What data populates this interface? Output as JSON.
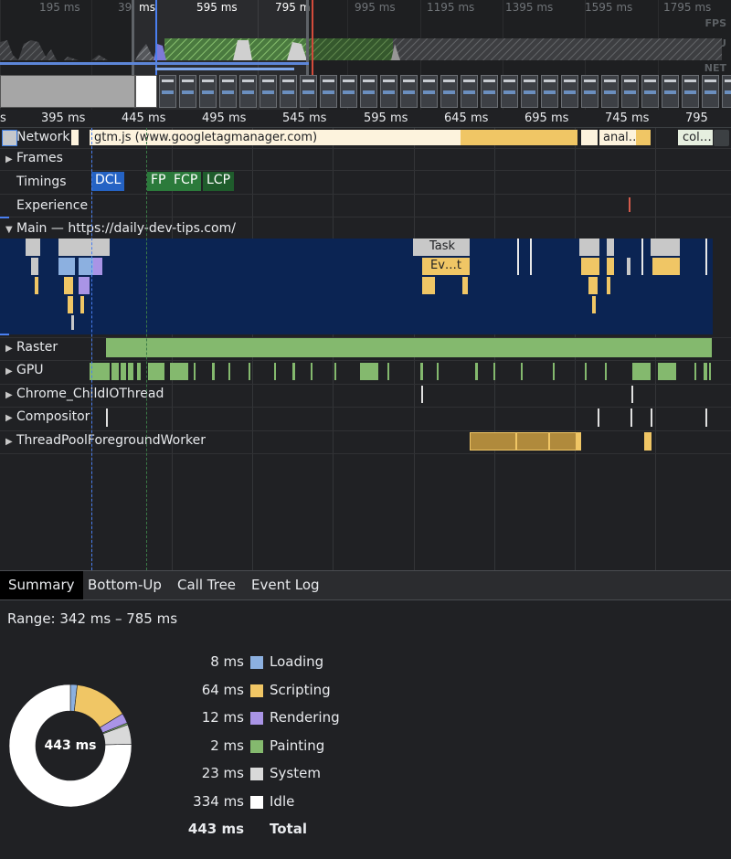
{
  "overview": {
    "ticks": [
      "195 ms",
      "39",
      "ms",
      "595 ms",
      "795 m",
      "995 ms",
      "1195 ms",
      "1395 ms",
      "1595 ms",
      "1795 ms"
    ],
    "row_labels": [
      "FPS",
      "CPU",
      "NET"
    ]
  },
  "ruler": {
    "labels": [
      "s",
      "395 ms",
      "445 ms",
      "495 ms",
      "545 ms",
      "595 ms",
      "645 ms",
      "695 ms",
      "745 ms",
      "795"
    ]
  },
  "tracks": {
    "network": {
      "label": "Network",
      "requests": [
        "gtm.js (www.googletagmanager.com)",
        "anal…",
        "col…"
      ]
    },
    "frames": {
      "label": "Frames"
    },
    "timings": {
      "label": "Timings",
      "markers": [
        "DCL",
        "FP",
        "FCP",
        "LCP"
      ]
    },
    "experience": {
      "label": "Experience"
    },
    "main": {
      "label": "Main — https://daily-dev-tips.com/",
      "task_label": "Task",
      "event_label": "Ev…t"
    },
    "raster": {
      "label": "Raster"
    },
    "gpu": {
      "label": "GPU"
    },
    "io": {
      "label": "Chrome_ChildIOThread"
    },
    "compositor": {
      "label": "Compositor"
    },
    "threadpool": {
      "label": "ThreadPoolForegroundWorker"
    }
  },
  "colors": {
    "loading": "#8cb0e0",
    "scripting": "#f0c665",
    "rendering": "#a994e6",
    "painting": "#84b96e",
    "system": "#d9d9d9",
    "idle": "#ffffff",
    "main_bg": "#0b2453",
    "dcl": "#2563c4",
    "paint_marker": "#2b7a3b"
  },
  "bottom": {
    "tabs": [
      "Summary",
      "Bottom-Up",
      "Call Tree",
      "Event Log"
    ],
    "range": "Range: 342 ms – 785 ms",
    "summary": [
      {
        "value": "8 ms",
        "name": "Loading",
        "color": "#8cb0e0",
        "ms": 8
      },
      {
        "value": "64 ms",
        "name": "Scripting",
        "color": "#f0c665",
        "ms": 64
      },
      {
        "value": "12 ms",
        "name": "Rendering",
        "color": "#a994e6",
        "ms": 12
      },
      {
        "value": "2 ms",
        "name": "Painting",
        "color": "#84b96e",
        "ms": 2
      },
      {
        "value": "23 ms",
        "name": "System",
        "color": "#d9d9d9",
        "ms": 23
      },
      {
        "value": "334 ms",
        "name": "Idle",
        "color": "#ffffff",
        "ms": 334
      }
    ],
    "total": {
      "value": "443 ms",
      "name": "Total"
    },
    "donut_center": "443 ms"
  }
}
